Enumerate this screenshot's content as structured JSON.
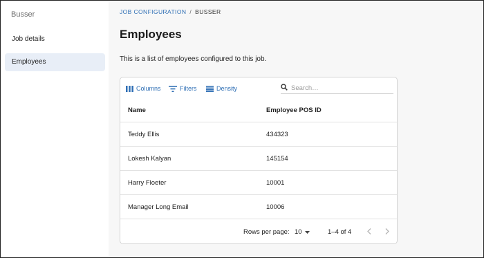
{
  "sidebar": {
    "app_name": "Busser",
    "items": [
      {
        "label": "Job details",
        "active": false
      },
      {
        "label": "Employees",
        "active": true
      }
    ]
  },
  "breadcrumb": {
    "parent": "JOB CONFIGURATION",
    "separator": "/",
    "current": "BUSSER"
  },
  "page": {
    "title": "Employees",
    "description": "This is a list of employees configured to this job."
  },
  "toolbar": {
    "columns_label": "Columns",
    "filters_label": "Filters",
    "density_label": "Density",
    "search_placeholder": "Search…"
  },
  "table": {
    "headers": {
      "name": "Name",
      "pos_id": "Employee POS ID"
    },
    "rows": [
      {
        "name": "Teddy Ellis",
        "pos_id": "434323"
      },
      {
        "name": "Lokesh Kalyan",
        "pos_id": "145154"
      },
      {
        "name": "Harry Floeter",
        "pos_id": "10001"
      },
      {
        "name": "Manager Long Email",
        "pos_id": "10006"
      }
    ]
  },
  "pagination": {
    "rows_per_page_label": "Rows per page:",
    "rows_per_page_value": "10",
    "range": "1–4 of 4"
  },
  "colors": {
    "accent": "#2f6fb5",
    "active_nav_bg": "#e8eef7",
    "page_bg": "#f7f7f7"
  }
}
